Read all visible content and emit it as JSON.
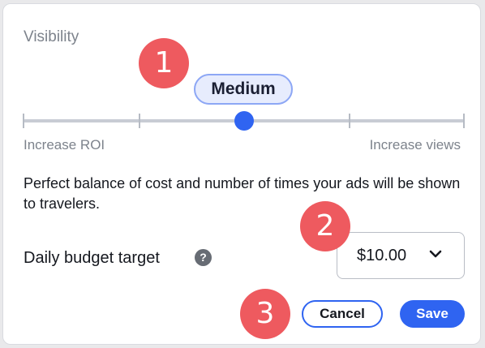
{
  "visibility": {
    "title": "Visibility",
    "level_label": "Medium",
    "min_label": "Increase ROI",
    "max_label": "Increase views",
    "level_fraction": 0.5,
    "description": "Perfect balance of cost and number of times your ads will be shown to travelers."
  },
  "budget": {
    "label": "Daily budget target",
    "help_icon_glyph": "?",
    "selected_value": "$10.00"
  },
  "actions": {
    "cancel_label": "Cancel",
    "save_label": "Save"
  },
  "markers": [
    "1",
    "2",
    "3"
  ],
  "colors": {
    "accent": "#2f64f1",
    "marker": "#ee5a5f",
    "pill_bg": "#e7ecfd",
    "pill_border": "#8da7f5"
  }
}
